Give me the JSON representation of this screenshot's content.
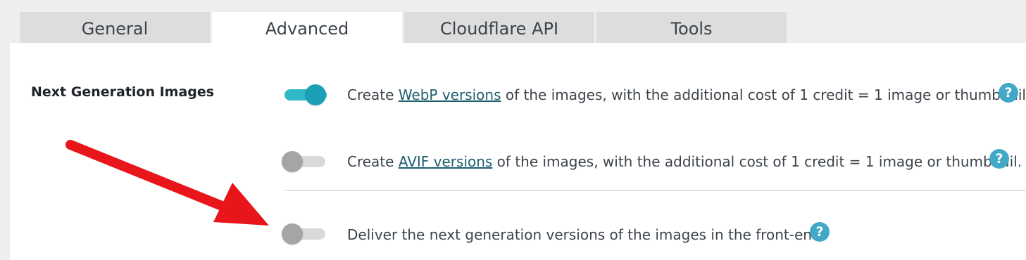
{
  "tabs": [
    {
      "label": "General"
    },
    {
      "label": "Advanced"
    },
    {
      "label": "Cloudflare API"
    },
    {
      "label": "Tools"
    }
  ],
  "active_tab": "Advanced",
  "section": {
    "label": "Next Generation Images"
  },
  "options": {
    "webp": {
      "prefix": "Create ",
      "link": "WebP versions",
      "suffix": " of the images, with the additional cost of 1 credit = 1 image or thumbnail.",
      "enabled": true
    },
    "avif": {
      "prefix": "Create ",
      "link": "AVIF versions",
      "suffix": " of the images, with the additional cost of 1 credit = 1 image or thumbnail.",
      "enabled": false
    },
    "deliver": {
      "text": "Deliver the next generation versions of the images in the front-end:",
      "enabled": false
    }
  },
  "help_icon_glyph": "?",
  "colors": {
    "toggle_on": "#1e9fb8",
    "toggle_off": "#a5a5a5",
    "help": "#41a9c7",
    "annotation_arrow": "#e8161b"
  }
}
